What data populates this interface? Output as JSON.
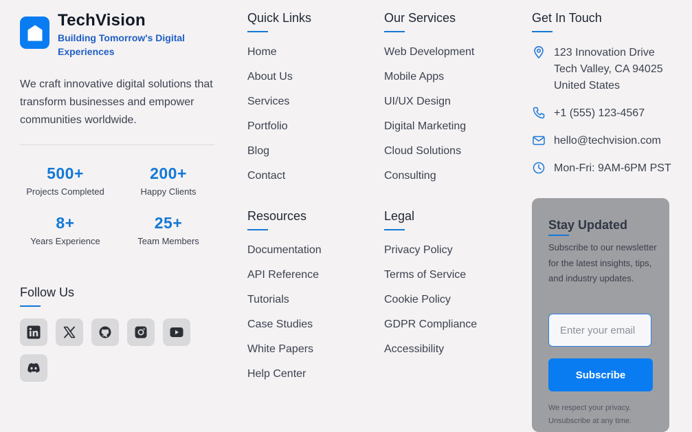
{
  "brand": {
    "name": "TechVision",
    "tagline": "Building Tomorrow's Digital Experiences",
    "description": "We craft innovative digital solutions that transform businesses and empower communities worldwide.",
    "accent_color": "#0a7cf2"
  },
  "stats": [
    {
      "value": "500+",
      "label": "Projects Completed"
    },
    {
      "value": "200+",
      "label": "Happy Clients"
    },
    {
      "value": "8+",
      "label": "Years Experience"
    },
    {
      "value": "25+",
      "label": "Team Members"
    }
  ],
  "follow": {
    "title": "Follow Us",
    "networks": [
      "linkedin-icon",
      "x-icon",
      "github-icon",
      "instagram-icon",
      "youtube-icon",
      "discord-icon"
    ]
  },
  "quick_links": {
    "title": "Quick Links",
    "items": [
      "Home",
      "About Us",
      "Services",
      "Portfolio",
      "Blog",
      "Contact"
    ]
  },
  "services": {
    "title": "Our Services",
    "items": [
      "Web Development",
      "Mobile Apps",
      "UI/UX Design",
      "Digital Marketing",
      "Cloud Solutions",
      "Consulting"
    ]
  },
  "resources": {
    "title": "Resources",
    "items": [
      "Documentation",
      "API Reference",
      "Tutorials",
      "Case Studies",
      "White Papers",
      "Help Center"
    ]
  },
  "legal": {
    "title": "Legal",
    "items": [
      "Privacy Policy",
      "Terms of Service",
      "Cookie Policy",
      "GDPR Compliance",
      "Accessibility"
    ]
  },
  "contact": {
    "title": "Get In Touch",
    "address_lines": [
      "123 Innovation Drive",
      "Tech Valley, CA 94025",
      "United States"
    ],
    "phone": "+1 (555) 123-4567",
    "email": "hello@techvision.com",
    "hours": "Mon-Fri: 9AM-6PM PST"
  },
  "newsletter": {
    "title": "Stay Updated",
    "description": "Subscribe to our newsletter for the latest insights, tips, and industry updates.",
    "email_placeholder": "Enter your email",
    "button_label": "Subscribe",
    "privacy_note": "We respect your privacy. Unsubscribe at any time."
  }
}
